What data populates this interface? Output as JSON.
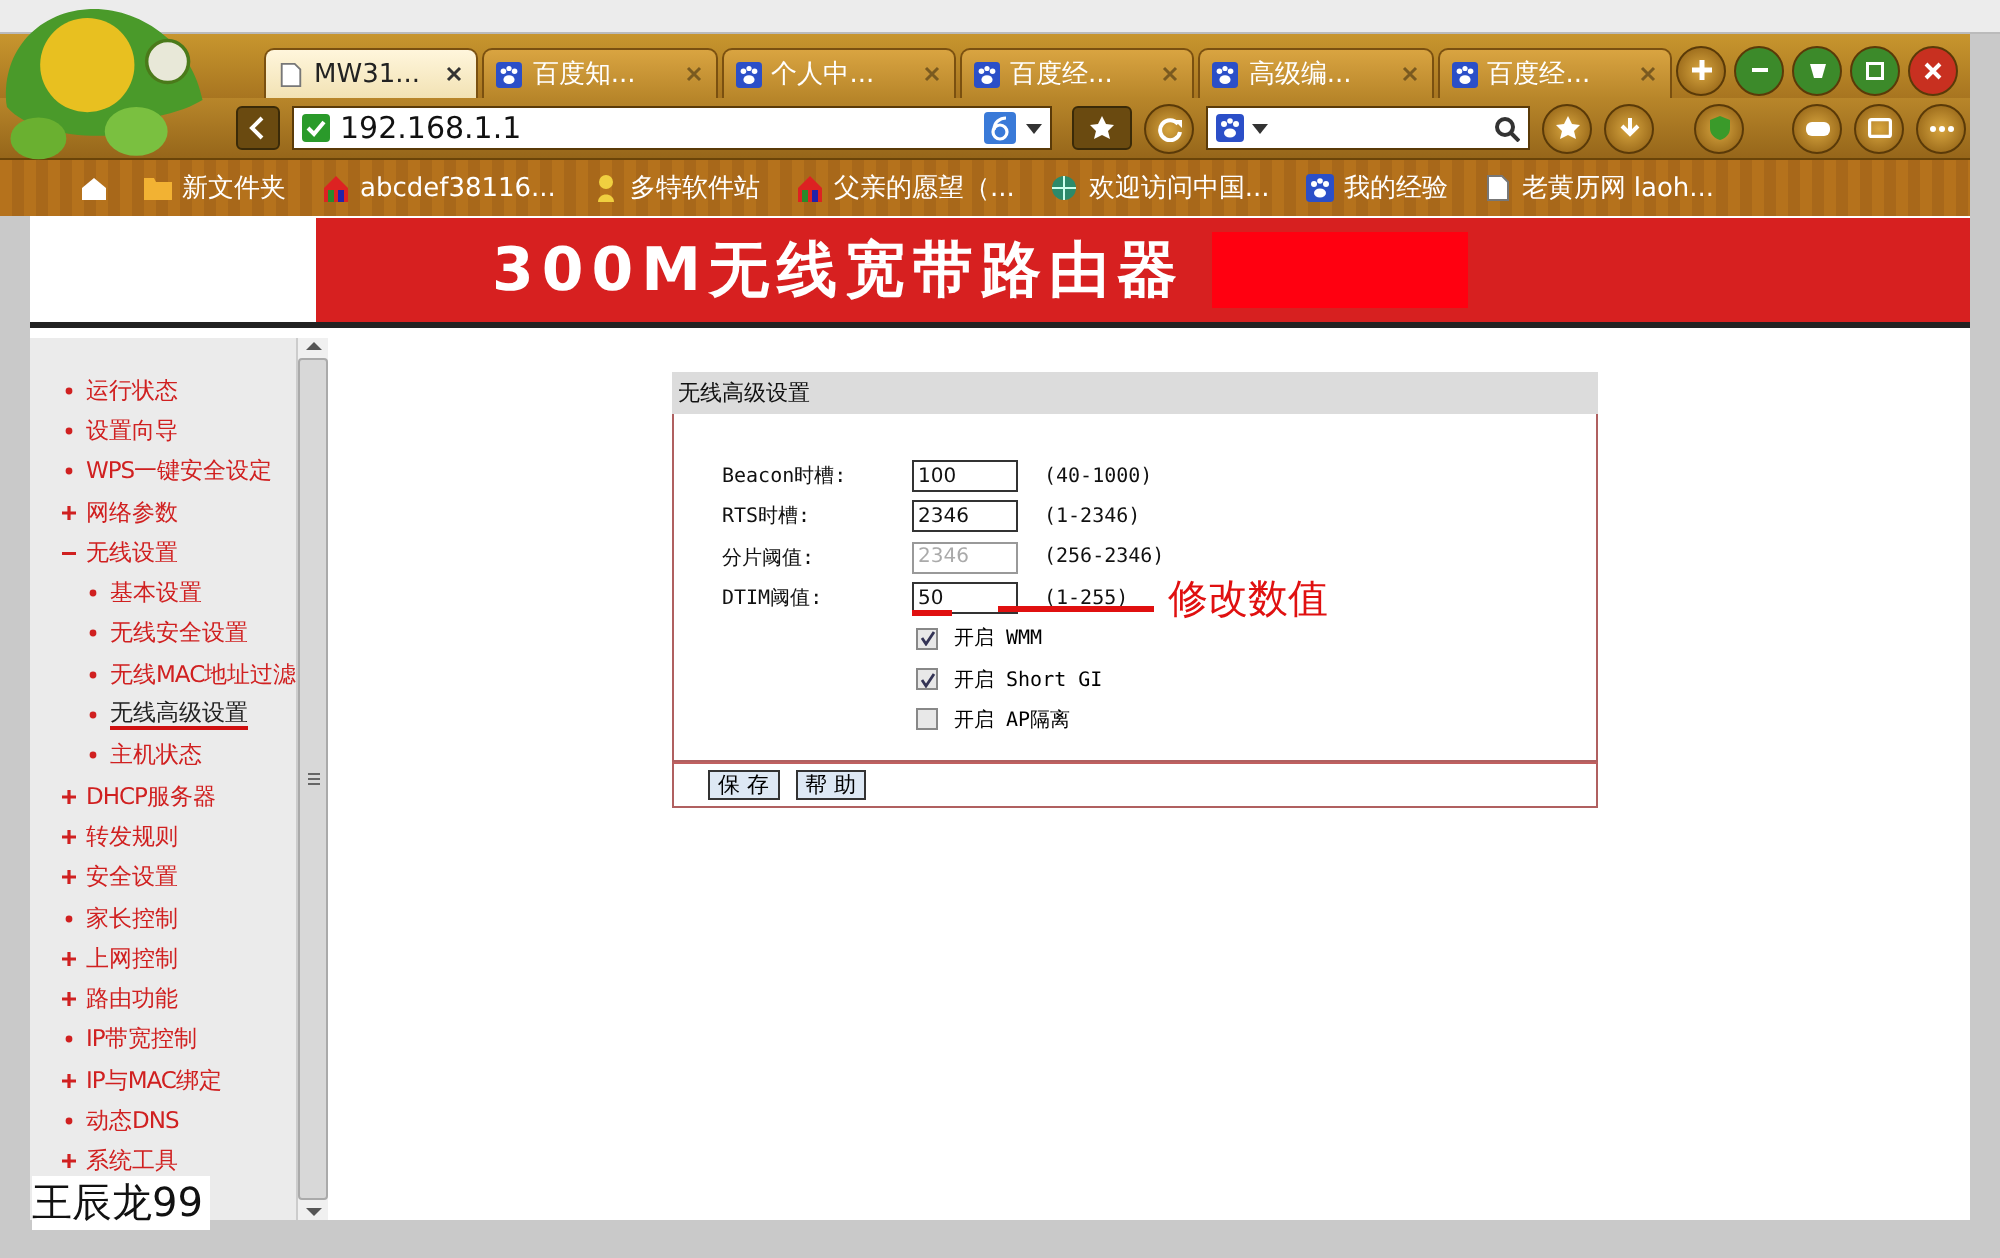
{
  "browser": {
    "tabs": [
      {
        "label": "MW31...",
        "selected": true,
        "kind": "page"
      },
      {
        "label": "百度知...",
        "selected": false,
        "kind": "paw"
      },
      {
        "label": "个人中...",
        "selected": false,
        "kind": "paw"
      },
      {
        "label": "百度经...",
        "selected": false,
        "kind": "paw"
      },
      {
        "label": "高级编...",
        "selected": false,
        "kind": "paw"
      },
      {
        "label": "百度经...",
        "selected": false,
        "kind": "paw"
      }
    ],
    "address": "192.168.1.1",
    "bookmarks": [
      {
        "label": "新文件夹",
        "kind": "folder"
      },
      {
        "label": "abcdef38116...",
        "kind": "house"
      },
      {
        "label": "多特软件站",
        "kind": "figure"
      },
      {
        "label": "父亲的愿望（...",
        "kind": "house"
      },
      {
        "label": "欢迎访问中国...",
        "kind": "globe"
      },
      {
        "label": "我的经验",
        "kind": "paw"
      },
      {
        "label": "老黄历网 laoh...",
        "kind": "page"
      }
    ]
  },
  "header": {
    "title": "300M无线宽带路由器"
  },
  "sidebar": {
    "items": [
      {
        "label": "运行状态",
        "kind": "leaf",
        "selected": false
      },
      {
        "label": "设置向导",
        "kind": "leaf",
        "selected": false
      },
      {
        "label": "WPS一键安全设定",
        "kind": "leaf",
        "selected": false
      },
      {
        "label": "网络参数",
        "kind": "group",
        "expanded": false,
        "selected": false
      },
      {
        "label": "无线设置",
        "kind": "group",
        "expanded": true,
        "selected": false,
        "children": [
          {
            "label": "基本设置",
            "kind": "leaf",
            "selected": false
          },
          {
            "label": "无线安全设置",
            "kind": "leaf",
            "selected": false
          },
          {
            "label": "无线MAC地址过滤",
            "kind": "leaf",
            "selected": false
          },
          {
            "label": "无线高级设置",
            "kind": "leaf",
            "selected": true
          },
          {
            "label": "主机状态",
            "kind": "leaf",
            "selected": false
          }
        ]
      },
      {
        "label": "DHCP服务器",
        "kind": "group",
        "expanded": false,
        "selected": false
      },
      {
        "label": "转发规则",
        "kind": "group",
        "expanded": false,
        "selected": false
      },
      {
        "label": "安全设置",
        "kind": "group",
        "expanded": false,
        "selected": false
      },
      {
        "label": "家长控制",
        "kind": "leaf",
        "selected": false
      },
      {
        "label": "上网控制",
        "kind": "group",
        "expanded": false,
        "selected": false
      },
      {
        "label": "路由功能",
        "kind": "group",
        "expanded": false,
        "selected": false
      },
      {
        "label": "IP带宽控制",
        "kind": "leaf",
        "selected": false
      },
      {
        "label": "IP与MAC绑定",
        "kind": "group",
        "expanded": false,
        "selected": false
      },
      {
        "label": "动态DNS",
        "kind": "leaf",
        "selected": false
      },
      {
        "label": "系统工具",
        "kind": "group",
        "expanded": false,
        "selected": false
      }
    ]
  },
  "panel": {
    "title": "无线高级设置",
    "fields": [
      {
        "label": "Beacon时槽:",
        "value": "100",
        "range": "(40-1000)",
        "disabled": false
      },
      {
        "label": "RTS时槽:",
        "value": "2346",
        "range": "(1-2346)",
        "disabled": false
      },
      {
        "label": "分片阈值:",
        "value": "2346",
        "range": "(256-2346)",
        "disabled": true
      },
      {
        "label": "DTIM阈值:",
        "value": "50",
        "range": "(1-255)",
        "disabled": false
      }
    ],
    "options": [
      {
        "label": "开启 WMM",
        "checked": true
      },
      {
        "label": "开启 Short GI",
        "checked": true
      },
      {
        "label": "开启 AP隔离",
        "checked": false
      }
    ],
    "buttons": [
      "保 存",
      "帮 助"
    ]
  },
  "annotation": {
    "note": "修改数值"
  },
  "author": "王辰龙99"
}
